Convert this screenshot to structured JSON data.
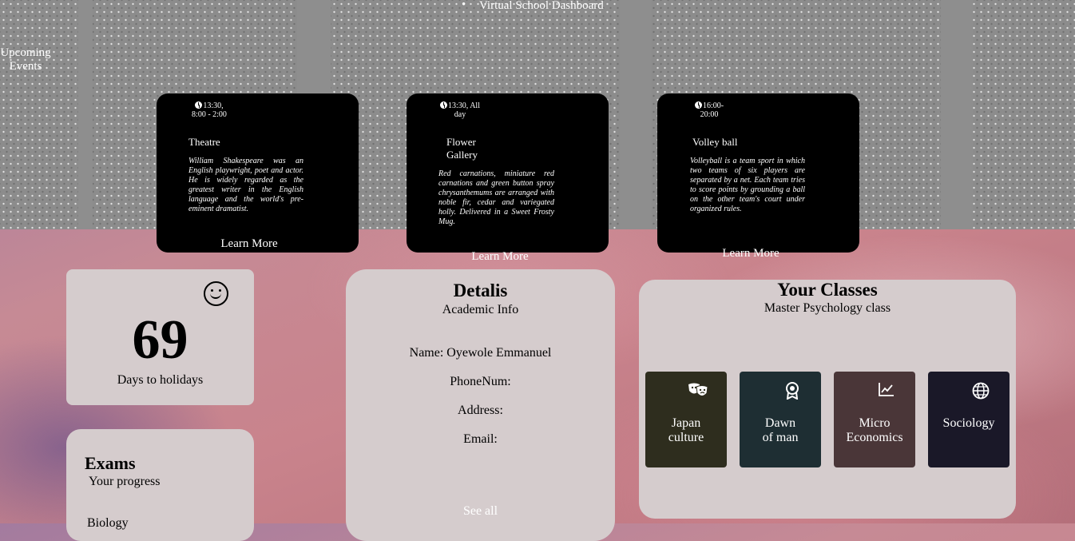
{
  "app": {
    "title": "Virtual School Dashboard"
  },
  "events": {
    "heading": "Upcoming Events",
    "items": [
      {
        "time": "13:30, 8:00 - 2:00",
        "time_line1": "13:30,",
        "time_line2": "8:00 - 2:00",
        "name": "Theatre",
        "description": "William Shakespeare was an English playwright, poet and actor. He is widely regarded as the greatest writer in the English language and the world's pre-eminent dramatist.",
        "link": "Learn More"
      },
      {
        "time": "13:30, All day",
        "time_line1": "13:30, All",
        "time_line2": "day",
        "name": "Flower Gallery",
        "description": "Red carnations, miniature red carnations and green button spray chrysanthemums are arranged with noble fir, cedar and variegated holly. Delivered in a Sweet Frosty Mug.",
        "link": "Learn More"
      },
      {
        "time": "16:00- 20:00",
        "time_line1": "16:00-",
        "time_line2": "20:00",
        "name": "Volley ball",
        "description": "Volleyball is a team sport in which two teams of six players are separated by a net. Each team tries to score points by grounding a ball on the other team's court under organized rules.",
        "link": "Learn More"
      }
    ]
  },
  "holidays": {
    "count": "69",
    "label": "Days to holidays",
    "icon": "smiley-icon"
  },
  "exams": {
    "title": "Exams",
    "subtitle": "Your progress",
    "item": "Biology"
  },
  "details": {
    "title": "Detalis",
    "subtitle": "Academic Info",
    "fields": [
      {
        "label": "Name: Oyewole Emmanuel"
      },
      {
        "label": "PhoneNum:"
      },
      {
        "label": "Address:"
      },
      {
        "label": "Email:"
      }
    ],
    "see_all": "See all"
  },
  "classes": {
    "title": "Your Classes",
    "subtitle": "Master Psychology class",
    "items": [
      {
        "name": "Japan culture",
        "line1": "Japan",
        "line2": "culture",
        "icon": "theater-masks-icon",
        "color": "#2e2d1e"
      },
      {
        "name": "Dawn of man",
        "line1": "Dawn",
        "line2": "of man",
        "icon": "award-icon",
        "color": "#1e2e33"
      },
      {
        "name": "Micro Economics",
        "line1": "Micro",
        "line2": "Economics",
        "icon": "chart-line-icon",
        "color": "#4a3638"
      },
      {
        "name": "Sociology",
        "line1": "Sociology",
        "line2": "",
        "icon": "globe-icon",
        "color": "#1a1828"
      }
    ]
  },
  "colors": {
    "event_card": "#000000",
    "panel": "#d5cccd",
    "band": "#8c8c8c"
  }
}
